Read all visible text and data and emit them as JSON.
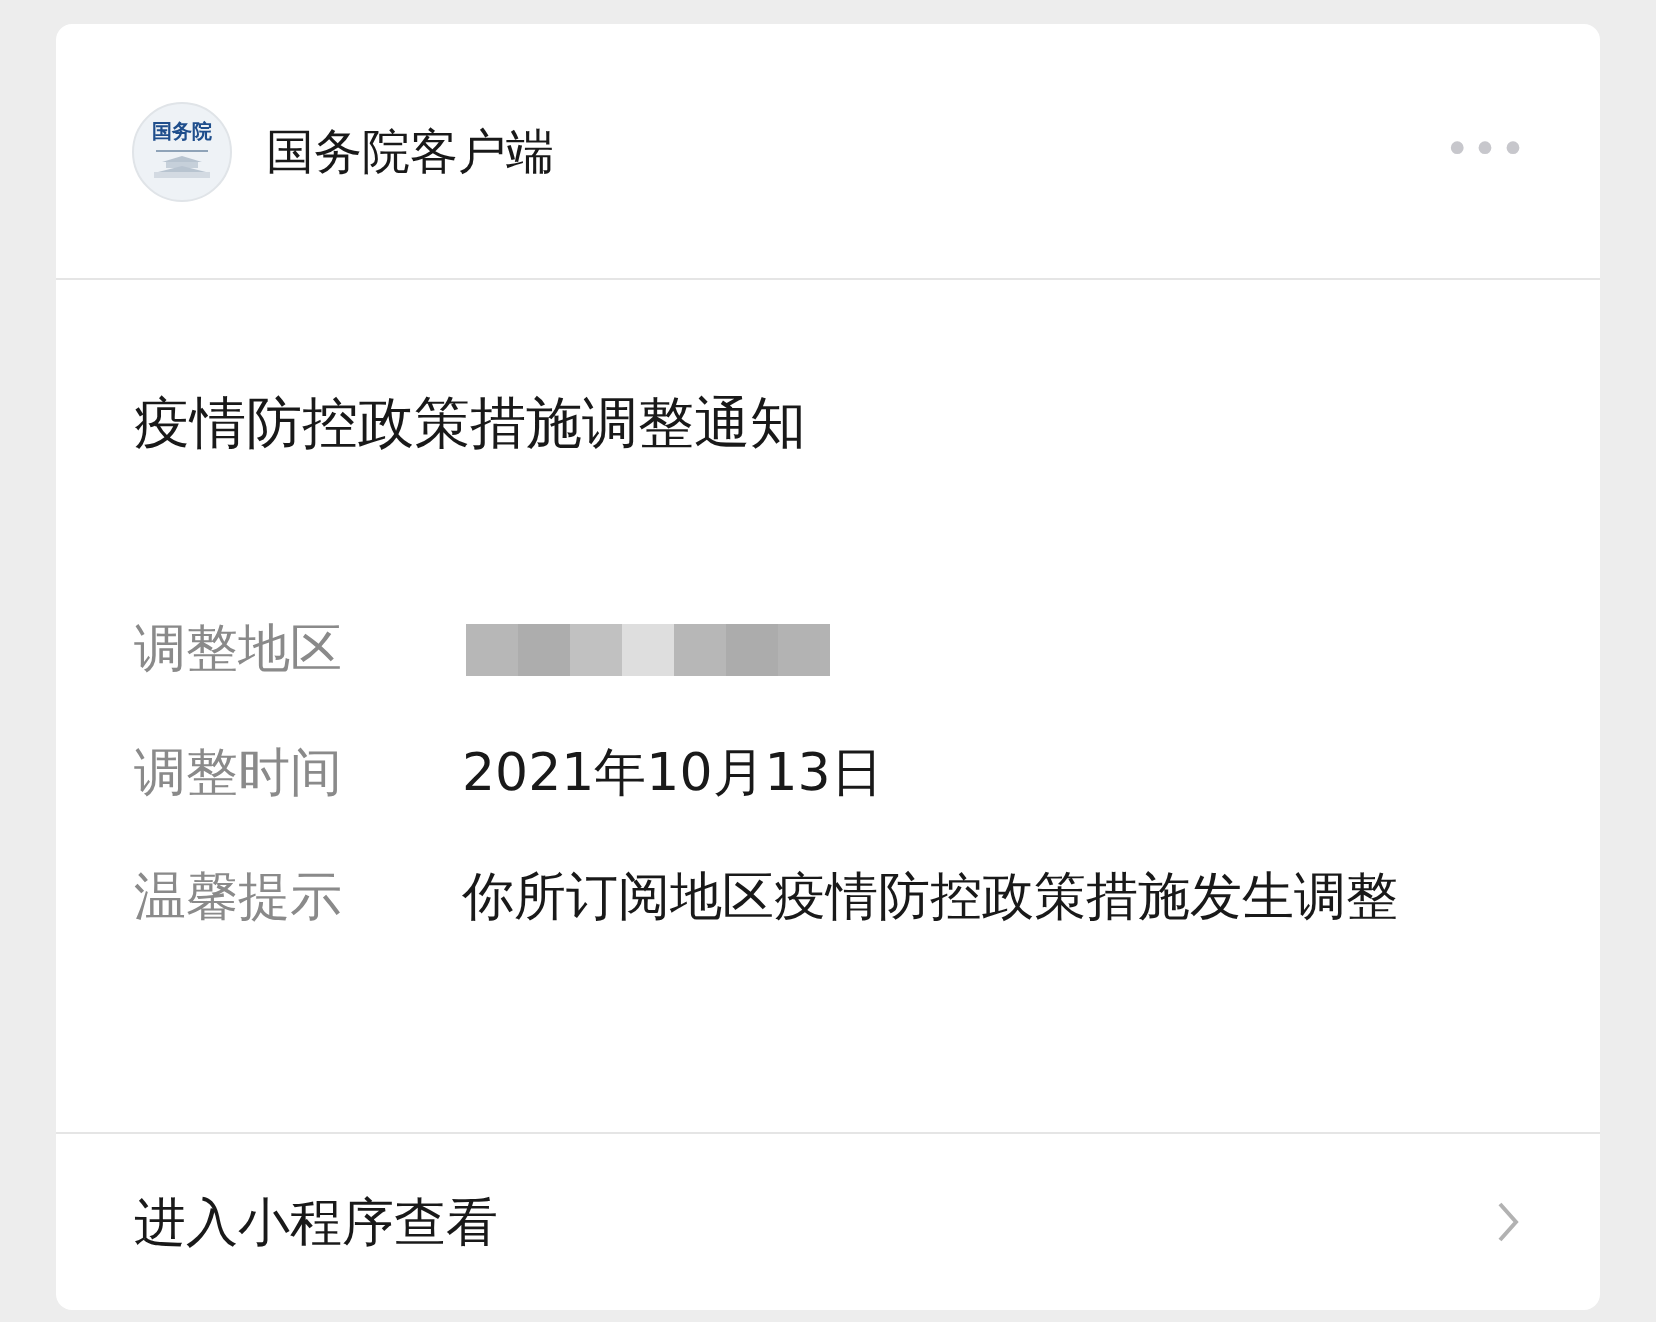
{
  "header": {
    "logo_text": "国务院",
    "account": "国务院客户端",
    "menu": "•••"
  },
  "title": "疫情防控政策措施调整通知",
  "fields": [
    {
      "label": "调整地区",
      "kind": "redacted"
    },
    {
      "label": "调整时间",
      "kind": "text",
      "value": "2021年10月13日"
    },
    {
      "label": "温馨提示",
      "kind": "text",
      "value": "你所订阅地区疫情防控政策措施发生调整"
    }
  ],
  "footer": {
    "action": "进入小程序查看"
  }
}
